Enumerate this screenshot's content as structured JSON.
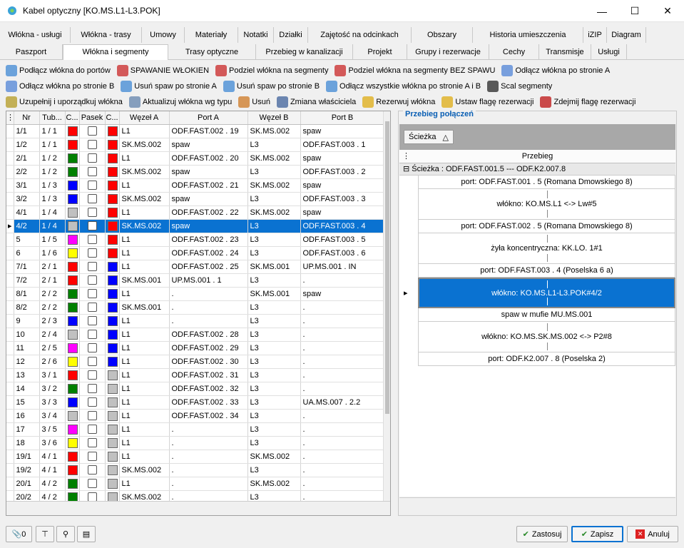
{
  "window": {
    "title": "Kabel optyczny [KO.MS.L1-L3.POK]",
    "minimize": "—",
    "maximize": "☐",
    "close": "✕"
  },
  "tabs_row1": [
    "Włókna - usługi",
    "Włókna - trasy",
    "Umowy",
    "Materiały",
    "Notatki",
    "Działki",
    "Zajętość na odcinkach",
    "Obszary",
    "Historia umieszczenia",
    "iZIP",
    "Diagram"
  ],
  "tabs_row2": [
    "Paszport",
    "Włókna i segmenty",
    "Trasy optyczne",
    "Przebieg w kanalizacji",
    "Projekt",
    "Grupy i rezerwacje",
    "Cechy",
    "Transmisje",
    "Usługi"
  ],
  "active_tab_row2": "Włókna i segmenty",
  "toolbar": {
    "row1": [
      "Podłącz włókna do portów",
      "SPAWANIE WŁOKIEN",
      "Podziel włókna na segmenty",
      "Podziel włókna na segmenty BEZ SPAWU",
      "Odłącz włókna po stronie A"
    ],
    "row2": [
      "Odłącz włókna po stronie B",
      "Usuń spaw po stronie A",
      "Usuń spaw po stronie B",
      "Odłącz wszystkie włókna po stronie A i B",
      "Scal segmenty"
    ],
    "row3": [
      "Uzupełnij i uporządkuj włókna",
      "Aktualizuj włókna wg typu",
      "Usuń",
      "Zmiana właściciela",
      "Rezerwuj włókna",
      "Ustaw flagę rezerwacji",
      "Zdejmij flagę rezerwacji"
    ]
  },
  "grid": {
    "columns": [
      "Nr",
      "Tub...",
      "C...",
      "Pasek",
      "C...",
      "Węzeł A",
      "Port A",
      "Węzeł B",
      "Port B"
    ],
    "rows": [
      {
        "nr": "1/1",
        "tub": "1 / 1",
        "c1": "#ff0000",
        "c2": "#ff0000",
        "wa": "L1",
        "pa": "ODF.FAST.002 . 19",
        "wb": "SK.MS.002",
        "pb": "spaw"
      },
      {
        "nr": "1/2",
        "tub": "1 / 1",
        "c1": "#ff0000",
        "c2": "#ff0000",
        "wa": "SK.MS.002",
        "pa": "spaw",
        "wb": "L3",
        "pb": "ODF.FAST.003 . 1"
      },
      {
        "nr": "2/1",
        "tub": "1 / 2",
        "c1": "#008000",
        "c2": "#ff0000",
        "wa": "L1",
        "pa": "ODF.FAST.002 . 20",
        "wb": "SK.MS.002",
        "pb": "spaw"
      },
      {
        "nr": "2/2",
        "tub": "1 / 2",
        "c1": "#008000",
        "c2": "#ff0000",
        "wa": "SK.MS.002",
        "pa": "spaw",
        "wb": "L3",
        "pb": "ODF.FAST.003 . 2"
      },
      {
        "nr": "3/1",
        "tub": "1 / 3",
        "c1": "#0000ff",
        "c2": "#ff0000",
        "wa": "L1",
        "pa": "ODF.FAST.002 . 21",
        "wb": "SK.MS.002",
        "pb": "spaw"
      },
      {
        "nr": "3/2",
        "tub": "1 / 3",
        "c1": "#0000ff",
        "c2": "#ff0000",
        "wa": "SK.MS.002",
        "pa": "spaw",
        "wb": "L3",
        "pb": "ODF.FAST.003 . 3"
      },
      {
        "nr": "4/1",
        "tub": "1 / 4",
        "c1": "#c0c0c0",
        "c2": "#ff0000",
        "wa": "L1",
        "pa": "ODF.FAST.002 . 22",
        "wb": "SK.MS.002",
        "pb": "spaw"
      },
      {
        "nr": "4/2",
        "tub": "1 / 4",
        "c1": "#c0c0c0",
        "c2": "#ff0000",
        "wa": "SK.MS.002",
        "pa": "spaw",
        "wb": "L3",
        "pb": "ODF.FAST.003 . 4",
        "selected": true
      },
      {
        "nr": "5",
        "tub": "1 / 5",
        "c1": "#ff00ff",
        "c2": "#ff0000",
        "wa": "L1",
        "pa": "ODF.FAST.002 . 23",
        "wb": "L3",
        "pb": "ODF.FAST.003 . 5"
      },
      {
        "nr": "6",
        "tub": "1 / 6",
        "c1": "#ffff00",
        "c2": "#ff0000",
        "wa": "L1",
        "pa": "ODF.FAST.002 . 24",
        "wb": "L3",
        "pb": "ODF.FAST.003 . 6"
      },
      {
        "nr": "7/1",
        "tub": "2 / 1",
        "c1": "#ff0000",
        "c2": "#0000ff",
        "wa": "L1",
        "pa": "ODF.FAST.002 . 25",
        "wb": "SK.MS.001",
        "pb": "UP.MS.001 . IN"
      },
      {
        "nr": "7/2",
        "tub": "2 / 1",
        "c1": "#ff0000",
        "c2": "#0000ff",
        "wa": "SK.MS.001",
        "pa": "UP.MS.001 . 1",
        "wb": "L3",
        "pb": "."
      },
      {
        "nr": "8/1",
        "tub": "2 / 2",
        "c1": "#008000",
        "c2": "#0000ff",
        "wa": "L1",
        "pa": ".",
        "wb": "SK.MS.001",
        "pb": "spaw"
      },
      {
        "nr": "8/2",
        "tub": "2 / 2",
        "c1": "#008000",
        "c2": "#0000ff",
        "wa": "SK.MS.001",
        "pa": ".",
        "wb": "L3",
        "pb": "."
      },
      {
        "nr": "9",
        "tub": "2 / 3",
        "c1": "#0000ff",
        "c2": "#0000ff",
        "wa": "L1",
        "pa": ".",
        "wb": "L3",
        "pb": "."
      },
      {
        "nr": "10",
        "tub": "2 / 4",
        "c1": "#c0c0c0",
        "c2": "#0000ff",
        "wa": "L1",
        "pa": "ODF.FAST.002 . 28",
        "wb": "L3",
        "pb": "."
      },
      {
        "nr": "11",
        "tub": "2 / 5",
        "c1": "#ff00ff",
        "c2": "#0000ff",
        "wa": "L1",
        "pa": "ODF.FAST.002 . 29",
        "wb": "L3",
        "pb": "."
      },
      {
        "nr": "12",
        "tub": "2 / 6",
        "c1": "#ffff00",
        "c2": "#0000ff",
        "wa": "L1",
        "pa": "ODF.FAST.002 . 30",
        "wb": "L3",
        "pb": "."
      },
      {
        "nr": "13",
        "tub": "3 / 1",
        "c1": "#ff0000",
        "c2": "#c0c0c0",
        "wa": "L1",
        "pa": "ODF.FAST.002 . 31",
        "wb": "L3",
        "pb": "."
      },
      {
        "nr": "14",
        "tub": "3 / 2",
        "c1": "#008000",
        "c2": "#c0c0c0",
        "wa": "L1",
        "pa": "ODF.FAST.002 . 32",
        "wb": "L3",
        "pb": "."
      },
      {
        "nr": "15",
        "tub": "3 / 3",
        "c1": "#0000ff",
        "c2": "#c0c0c0",
        "wa": "L1",
        "pa": "ODF.FAST.002 . 33",
        "wb": "L3",
        "pb": "UA.MS.007 . 2.2"
      },
      {
        "nr": "16",
        "tub": "3 / 4",
        "c1": "#c0c0c0",
        "c2": "#c0c0c0",
        "wa": "L1",
        "pa": "ODF.FAST.002 . 34",
        "wb": "L3",
        "pb": "."
      },
      {
        "nr": "17",
        "tub": "3 / 5",
        "c1": "#ff00ff",
        "c2": "#c0c0c0",
        "wa": "L1",
        "pa": ".",
        "wb": "L3",
        "pb": "."
      },
      {
        "nr": "18",
        "tub": "3 / 6",
        "c1": "#ffff00",
        "c2": "#c0c0c0",
        "wa": "L1",
        "pa": ".",
        "wb": "L3",
        "pb": "."
      },
      {
        "nr": "19/1",
        "tub": "4 / 1",
        "c1": "#ff0000",
        "c2": "#c0c0c0",
        "wa": "L1",
        "pa": ".",
        "wb": "SK.MS.002",
        "pb": "."
      },
      {
        "nr": "19/2",
        "tub": "4 / 1",
        "c1": "#ff0000",
        "c2": "#c0c0c0",
        "wa": "SK.MS.002",
        "pa": ".",
        "wb": "L3",
        "pb": "."
      },
      {
        "nr": "20/1",
        "tub": "4 / 2",
        "c1": "#008000",
        "c2": "#c0c0c0",
        "wa": "L1",
        "pa": ".",
        "wb": "SK.MS.002",
        "pb": "."
      },
      {
        "nr": "20/2",
        "tub": "4 / 2",
        "c1": "#008000",
        "c2": "#c0c0c0",
        "wa": "SK.MS.002",
        "pa": ".",
        "wb": "L3",
        "pb": "."
      }
    ]
  },
  "right_panel": {
    "title": "Przebieg połączeń",
    "group_by": "Ścieżka",
    "column_header": "Przebieg",
    "group_label": "Ścieżka : ODF.FAST.001.5 --- ODF.K2.007.8",
    "rows": [
      {
        "text": "port: ODF.FAST.001 . 5 (Romana Dmowskiego 8)",
        "tall": false
      },
      {
        "text": "włókno: KO.MS.L1 <-> Lw#5",
        "tall": true
      },
      {
        "text": "port: ODF.FAST.002 . 5 (Romana Dmowskiego 8)",
        "tall": false
      },
      {
        "text": "żyła koncentryczna: KK.LO. 1#1",
        "tall": true
      },
      {
        "text": "port: ODF.FAST.003 . 4 (Poselska 6 a)",
        "tall": false
      },
      {
        "text": "włókno: KO.MS.L1-L3.POK#4/2",
        "tall": true,
        "selected": true
      },
      {
        "text": "spaw w mufie MU.MS.001",
        "tall": false
      },
      {
        "text": "włókno: KO.MS.SK.MS.002 <-> P2#8",
        "tall": true
      },
      {
        "text": "port: ODF.K2.007 . 8 (Poselska 2)",
        "tall": false
      }
    ]
  },
  "status": {
    "attachments_count": "0",
    "apply": "Zastosuj",
    "save": "Zapisz",
    "cancel": "Anuluj"
  }
}
